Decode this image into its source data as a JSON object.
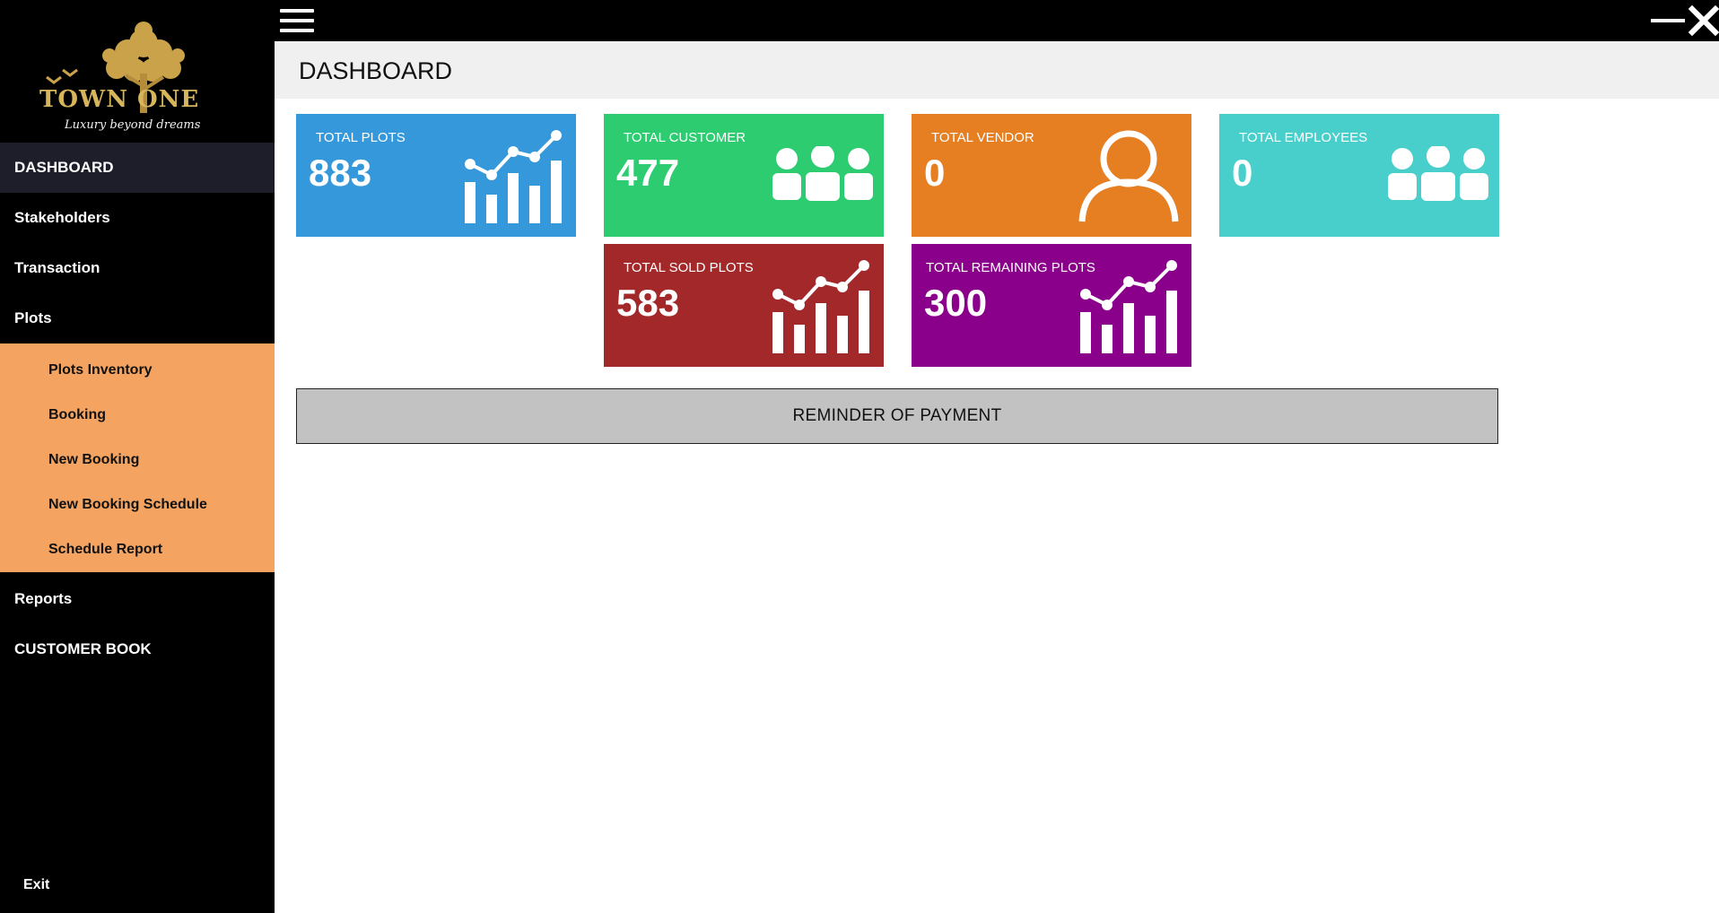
{
  "brand": {
    "name": "TOWN ONE",
    "tagline": "Luxury beyond dreams"
  },
  "sidebar": {
    "items": [
      {
        "label": "DASHBOARD"
      },
      {
        "label": "Stakeholders"
      },
      {
        "label": "Transaction"
      },
      {
        "label": "Plots"
      },
      {
        "label": "Reports"
      },
      {
        "label": "CUSTOMER BOOK"
      }
    ],
    "submenu": [
      {
        "label": "Plots Inventory"
      },
      {
        "label": "Booking"
      },
      {
        "label": "New Booking"
      },
      {
        "label": "New Booking Schedule"
      },
      {
        "label": "Schedule Report"
      }
    ],
    "exit_label": "Exit"
  },
  "header": {
    "title": "DASHBOARD"
  },
  "cards": [
    {
      "label": "TOTAL PLOTS",
      "value": "883",
      "color": "#3498db",
      "icon": "chart-icon"
    },
    {
      "label": "TOTAL CUSTOMER",
      "value": "477",
      "color": "#2ecc71",
      "icon": "users-icon"
    },
    {
      "label": "TOTAL VENDOR",
      "value": "0",
      "color": "#e67e22",
      "icon": "user-icon"
    },
    {
      "label": "TOTAL EMPLOYEES",
      "value": "0",
      "color": "#48cfcb",
      "icon": "users-icon"
    },
    {
      "label": "TOTAL SOLD PLOTS",
      "value": "583",
      "color": "#a3282a",
      "icon": "chart-icon"
    },
    {
      "label": "TOTAL REMAINING PLOTS",
      "value": "300",
      "color": "#8b008b",
      "icon": "chart-icon"
    }
  ],
  "reminder_label": "REMINDER OF PAYMENT",
  "colors": {
    "sidebar_bg": "#000000",
    "submenu_bg": "#f4a460",
    "active_item_bg": "#1e1e2a",
    "brand_gold": "#d7b55a"
  }
}
